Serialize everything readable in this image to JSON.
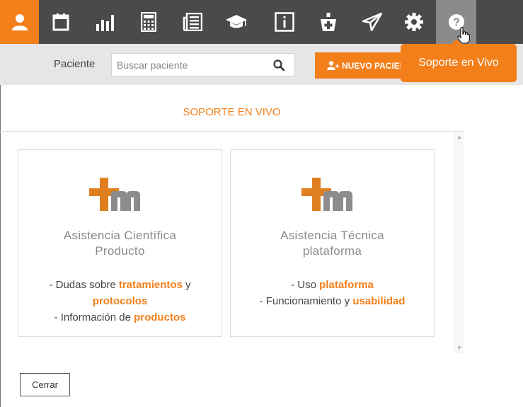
{
  "nav": {
    "items": [
      {
        "name": "user-icon",
        "active": true
      },
      {
        "name": "calendar-icon"
      },
      {
        "name": "bar-chart-icon"
      },
      {
        "name": "calculator-icon"
      },
      {
        "name": "newspaper-icon"
      },
      {
        "name": "graduation-cap-icon"
      },
      {
        "name": "info-icon"
      },
      {
        "name": "medical-kit-icon"
      },
      {
        "name": "paper-plane-icon"
      },
      {
        "name": "gear-icon"
      },
      {
        "name": "help-icon",
        "hover": true
      }
    ],
    "tooltip": "Soporte en Vivo"
  },
  "patient_bar": {
    "label": "Paciente",
    "search_placeholder": "Buscar paciente",
    "new_button_label": "NUEVO PACIENTE"
  },
  "modal": {
    "title": "SOPORTE EN VIVO",
    "cards": [
      {
        "title_line1": "Asistencia Científica",
        "title_line2": "Producto",
        "items": [
          {
            "prefix": "- Dudas sobre ",
            "highlight": "tratamientos",
            "suffix": " y"
          },
          {
            "prefix": "",
            "highlight": "protocolos",
            "suffix": ""
          },
          {
            "prefix": "- Información de ",
            "highlight": "productos",
            "suffix": ""
          }
        ]
      },
      {
        "title_line1": "Asistencia Técnica",
        "title_line2": "plataforma",
        "items": [
          {
            "prefix": "- Uso ",
            "highlight": "plataforma",
            "suffix": ""
          },
          {
            "prefix": "- Funcionamiento y ",
            "highlight": "usabilidad",
            "suffix": ""
          }
        ]
      }
    ],
    "close_label": "Cerrar"
  },
  "colors": {
    "accent": "#f37f1a",
    "nav_bg": "#4a4a4a",
    "logo_gray": "#8c8c8c"
  }
}
